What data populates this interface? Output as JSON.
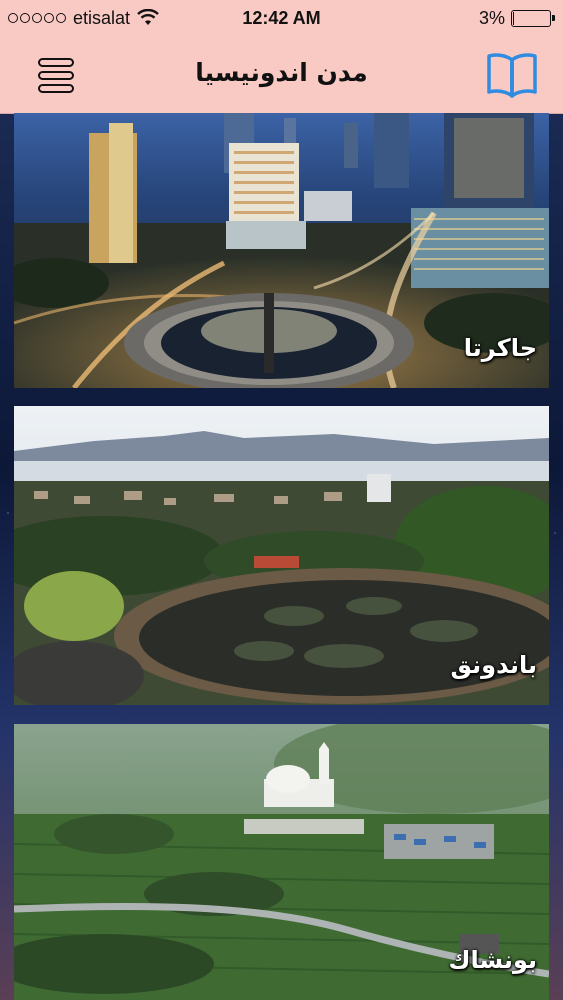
{
  "status_bar": {
    "carrier": "etisalat",
    "time": "12:42 AM",
    "battery_percent": "3%",
    "battery_level": 0.03
  },
  "nav": {
    "title": "مدن اندونيسيا",
    "menu_icon": "hamburger-menu-icon",
    "book_icon": "open-book-icon",
    "accent_color": "#2f8ce0",
    "bar_color": "#f9c9c4"
  },
  "cities": [
    {
      "name": "جاكرتا"
    },
    {
      "name": "باندونق"
    },
    {
      "name": "بونشاك"
    }
  ]
}
